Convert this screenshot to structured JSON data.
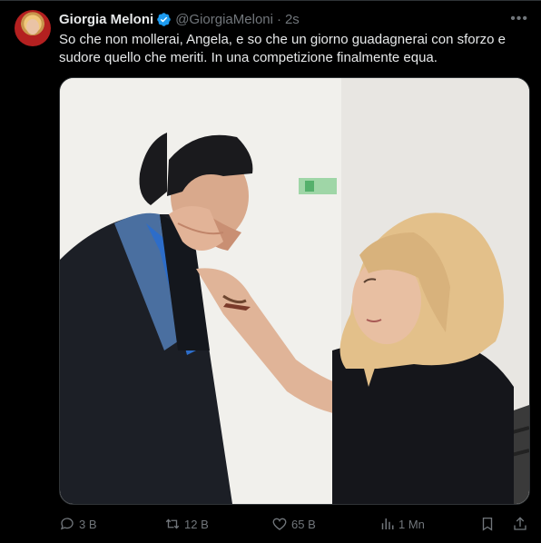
{
  "author": {
    "name": "Giorgia Meloni",
    "handle": "@GiorgiaMeloni",
    "time": "2s"
  },
  "tweet_text": "So che non mollerai, Angela, e so che un giorno guadagnerai con sforzo e sudore quello che meriti. In una competizione finalmente equa.",
  "actions": {
    "replies": "3 B",
    "reposts": "12 B",
    "likes": "65 B",
    "views": "1 Mn"
  },
  "colors": {
    "background": "#000000",
    "text": "#e7e9ea",
    "muted": "#71767b",
    "verified": "#1d9bf0"
  },
  "icons": [
    "verified-badge-icon",
    "more-icon",
    "reply-icon",
    "repost-icon",
    "like-icon",
    "views-icon",
    "bookmark-icon",
    "share-icon"
  ]
}
